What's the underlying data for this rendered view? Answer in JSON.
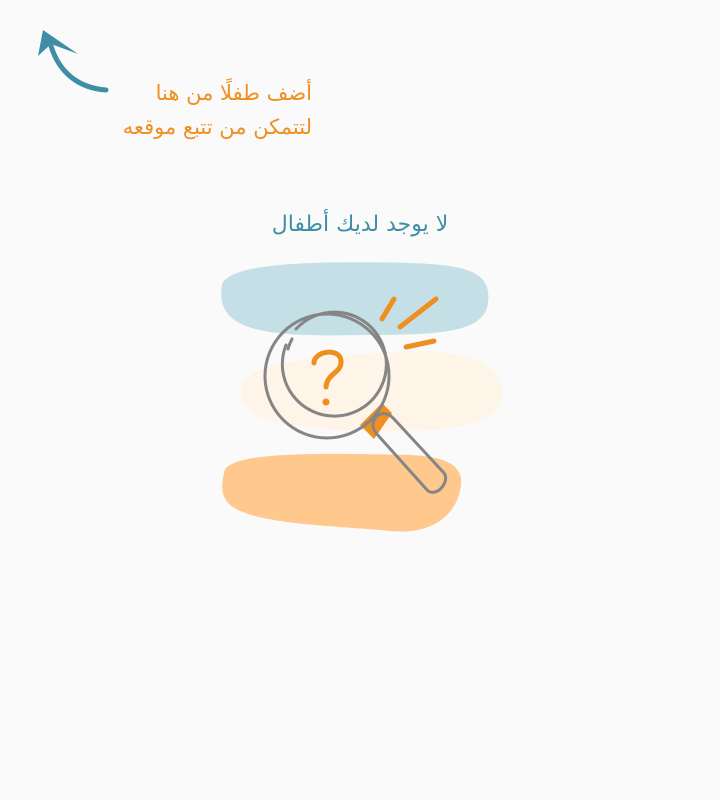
{
  "hint": {
    "line1": "أضف طفلًا من هنا",
    "line2": "لتتمكن من تتبع موقعه",
    "icon": "curved-arrow-up-left-icon"
  },
  "empty_state": {
    "title": "لا يوجد لديك أطفال",
    "illustration": "magnifier-question-icon"
  },
  "colors": {
    "background": "#fafafa",
    "accent_orange": "#ef8f1f",
    "accent_teal": "#3e8fa5",
    "blob_blue": "#c4dfe6",
    "blob_cream": "#fff4e8",
    "blob_orange": "#ffc88c",
    "outline_gray": "#858585"
  }
}
